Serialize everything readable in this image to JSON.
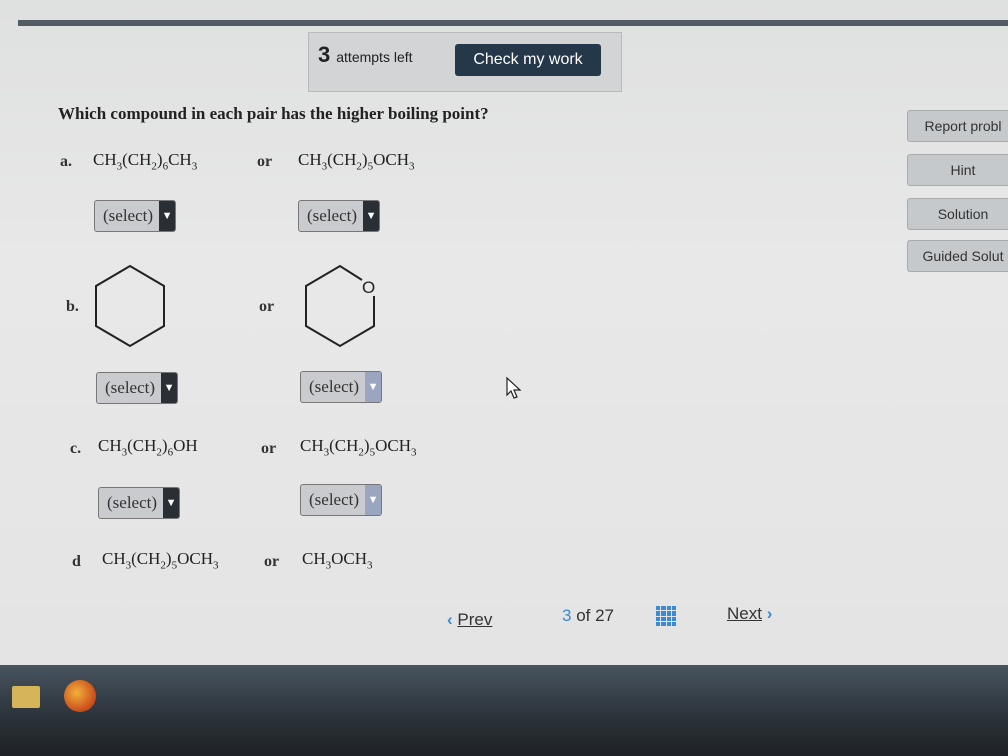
{
  "header": {
    "attempts_count": "3",
    "attempts_label": "attempts left",
    "check_button": "Check my work"
  },
  "question": "Which compound in each pair has the higher boiling point?",
  "items": [
    {
      "label": "a.",
      "left": [
        "CH",
        "3",
        "(CH",
        "2",
        ")",
        "6",
        "CH",
        "3"
      ],
      "or": "or",
      "right": [
        "CH",
        "3",
        "(CH",
        "2",
        ")",
        "5",
        "OCH",
        "3"
      ],
      "select_left": "(select)",
      "select_right": "(select)"
    },
    {
      "label": "b.",
      "left_structure": "cyclohexane",
      "or": "or",
      "right_structure": "tetrahydropyran",
      "ring_atom": "O",
      "select_left": "(select)",
      "select_right": "(select)"
    },
    {
      "label": "c.",
      "left": [
        "CH",
        "3",
        "(CH",
        "2",
        ")",
        "6",
        "OH"
      ],
      "or": "or",
      "right": [
        "CH",
        "3",
        "(CH",
        "2",
        ")",
        "5",
        "OCH",
        "3"
      ],
      "select_left": "(select)",
      "select_right": "(select)"
    },
    {
      "label": "d",
      "left": [
        "CH",
        "3",
        "(CH",
        "2",
        ")",
        "5",
        "OCH",
        "3"
      ],
      "or": "or",
      "right": [
        "CH",
        "3",
        "OCH",
        "3"
      ]
    }
  ],
  "sidebar": {
    "report": "Report probl",
    "hint": "Hint",
    "solution": "Solution",
    "guided": "Guided Solut"
  },
  "navigation": {
    "prev": "Prev",
    "current": "3",
    "of_total": "of 27",
    "next": "Next"
  },
  "colors": {
    "accent": "#3a8ad6",
    "check_button_bg": "#24384a",
    "select_arrow_bg": "#2a2f36"
  },
  "icons": [
    "grid-icon",
    "chevron-left-icon",
    "chevron-right-icon",
    "dropdown-arrow-icon",
    "mouse-cursor-icon",
    "folder-icon",
    "firefox-icon"
  ]
}
